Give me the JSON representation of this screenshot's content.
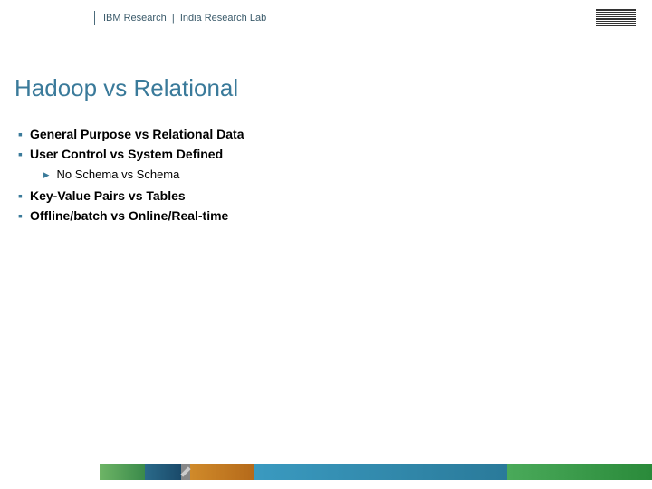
{
  "header": {
    "org": "IBM Research",
    "sep": "|",
    "lab": "India Research Lab"
  },
  "title": "Hadoop vs Relational",
  "bullets": [
    "General Purpose vs Relational Data",
    "User Control vs System Defined"
  ],
  "sub": "No Schema vs Schema",
  "bullets2": [
    "Key-Value Pairs vs Tables",
    "Offline/batch vs Online/Real-time"
  ]
}
